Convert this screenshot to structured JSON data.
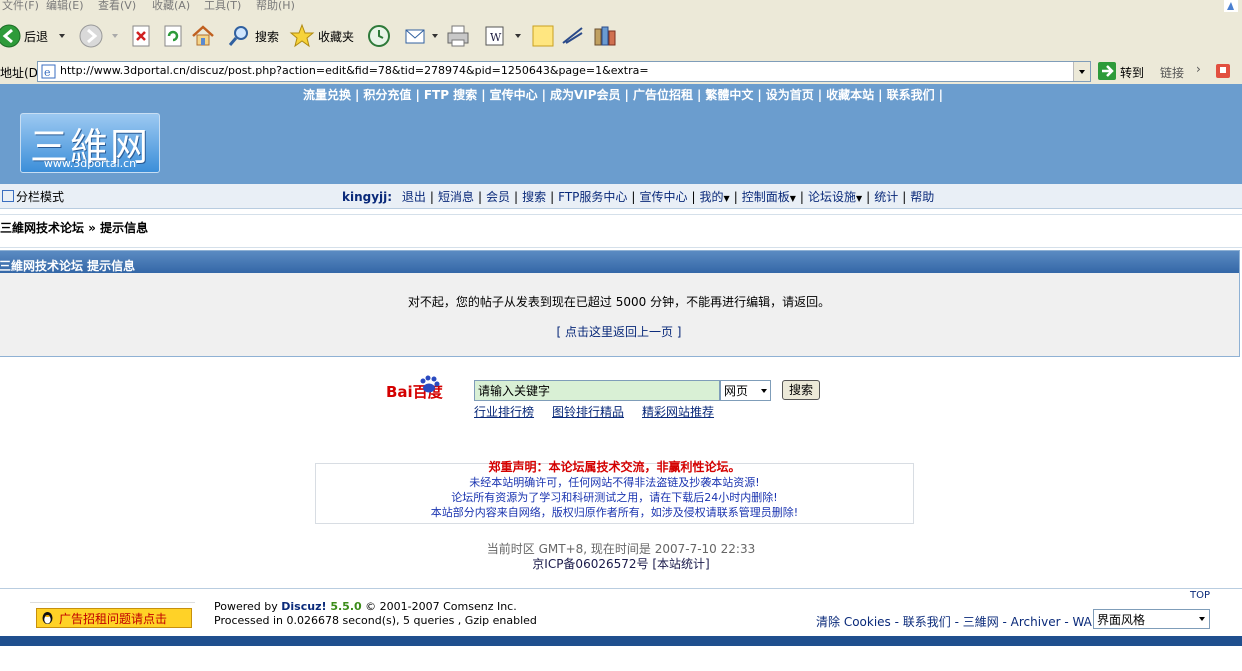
{
  "browser": {
    "menu": [
      "文件(F)",
      "编辑(E)",
      "查看(V)",
      "收藏(A)",
      "工具(T)",
      "帮助(H)"
    ],
    "toolbar": {
      "back_label": "后退",
      "search_label": "搜索",
      "favorites_label": "收藏夹"
    },
    "address": {
      "label": "地址(D)",
      "url": "http://www.3dportal.cn/discuz/post.php?action=edit&fid=78&tid=278974&pid=1250643&page=1&extra=",
      "go_label": "转到",
      "links_label": "链接"
    }
  },
  "site": {
    "topnav": [
      "流量兑换",
      "积分充值",
      "FTP 搜索",
      "宣传中心",
      "成为VIP会员",
      "广告位招租",
      "繁體中文",
      "设为首页",
      "收藏本站",
      "联系我们"
    ],
    "logo": {
      "main": "三維网",
      "sub": "www.3dportal.cn"
    },
    "split_mode": "分栏模式",
    "user": {
      "name": "kingyjj:",
      "menu": [
        "退出",
        "短消息",
        "会员",
        "搜索",
        "FTP服务中心",
        "宣传中心",
        "我的",
        "控制面板",
        "论坛设施",
        "统计",
        "帮助"
      ]
    },
    "breadcrumb": "三維网技术论坛 » 提示信息"
  },
  "message": {
    "header": "三維网技术论坛 提示信息",
    "text": "对不起，您的帖子从发表到现在已超过 5000 分钟，不能再进行编辑，请返回。",
    "back_link": "[ 点击这里返回上一页 ]"
  },
  "baidu": {
    "logo": "Bai百度",
    "input_value": "请输入关键字",
    "select_value": "网页",
    "search_button": "搜索",
    "links": [
      "行业排行榜",
      "图铃排行精品",
      "精彩网站推荐"
    ]
  },
  "statement": {
    "heading": "郑重声明：本论坛属技术交流，非赢利性论坛。",
    "lines": [
      "未经本站明确许可，任何网站不得非法盗链及抄袭本站资源!",
      "论坛所有资源为了学习和科研测试之用，请在下载后24小时内删除!",
      "本站部分内容来自网络，版权归原作者所有，如涉及侵权请联系管理员删除!"
    ]
  },
  "timeinfo": "当前时区 GMT+8, 现在时间是 2007-7-10 22:33",
  "icp": "京ICP备06026572号 [本站统计]",
  "footer": {
    "top_label": "TOP",
    "ad_button": "广告招租问题请点击",
    "powered_line1_prefix": "Powered by ",
    "powered_brand": "Discuz!",
    "powered_version": " 5.5.0",
    "powered_copyright": "  © 2001-2007 Comsenz Inc.",
    "powered_line2": "Processed in 0.026678 second(s), 5 queries , Gzip enabled",
    "links": "清除 Cookies - 联系我们 - 三維网 - Archiver - WAP",
    "style_select": "界面风格"
  },
  "colors": {
    "header_bg": "#6b9dce",
    "message_header": "#3467a7",
    "link": "#0a2a7a",
    "warning": "#d40000"
  }
}
